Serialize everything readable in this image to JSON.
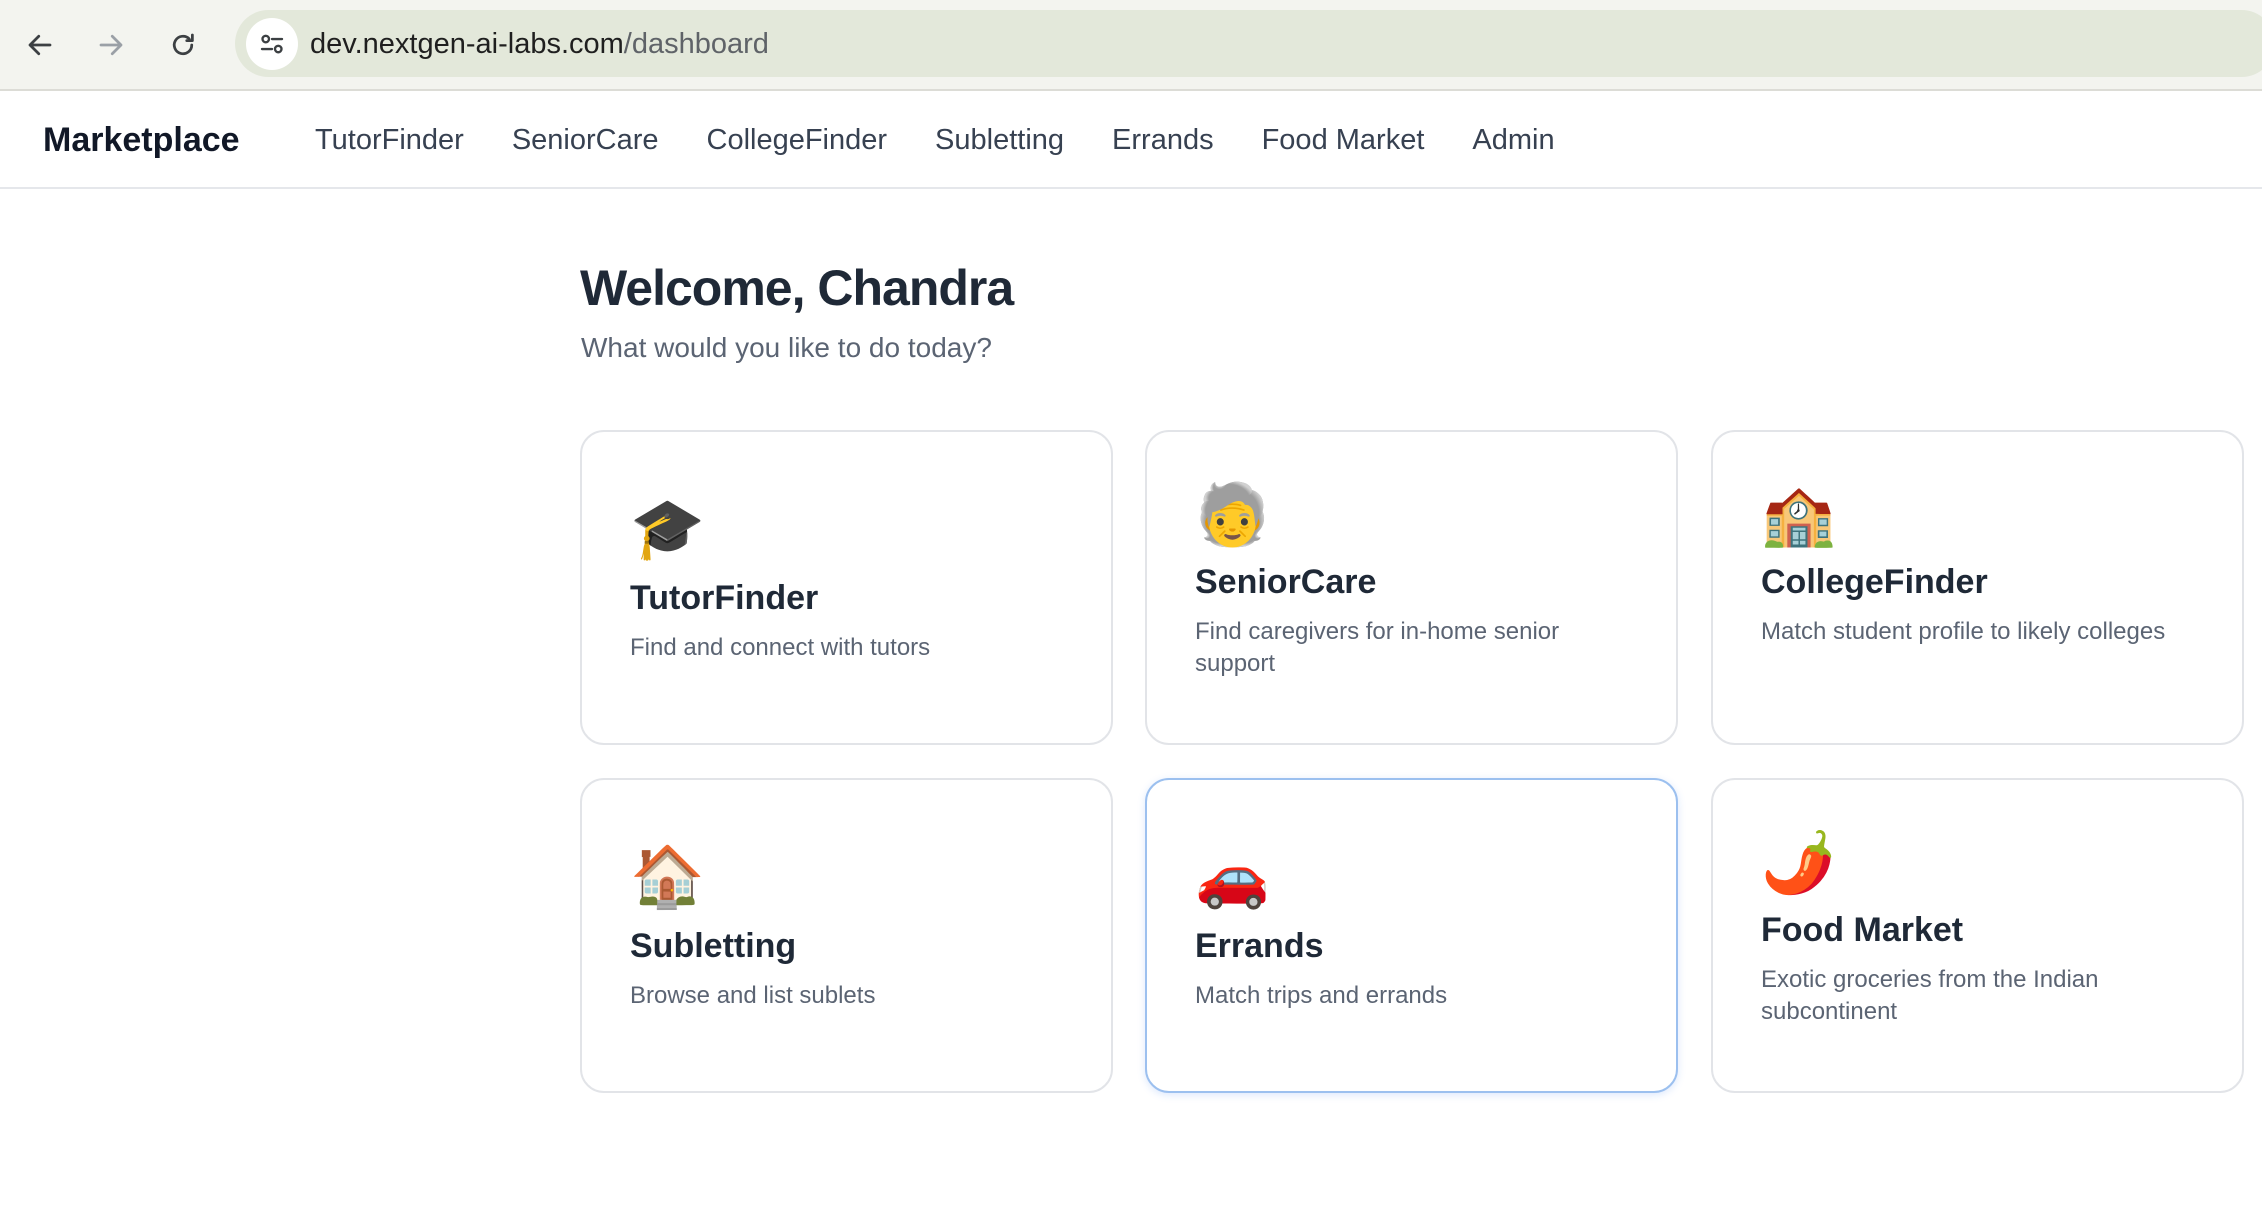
{
  "browser": {
    "url_host": "dev.nextgen-ai-labs.com",
    "url_path": "/dashboard",
    "back_icon": "arrow-left-icon",
    "forward_icon": "arrow-right-icon",
    "reload_icon": "reload-icon",
    "site_info_icon": "tune-icon"
  },
  "header": {
    "brand": "Marketplace",
    "nav": [
      "TutorFinder",
      "SeniorCare",
      "CollegeFinder",
      "Subletting",
      "Errands",
      "Food Market",
      "Admin"
    ]
  },
  "main": {
    "welcome": "Welcome, Chandra",
    "subtitle": "What would you like to do today?",
    "cards": [
      {
        "icon": "🎓",
        "icon_name": "graduation-cap-icon",
        "title": "TutorFinder",
        "desc": "Find and connect with tutors"
      },
      {
        "icon": "🧓",
        "icon_name": "older-person-icon",
        "title": "SeniorCare",
        "desc": "Find caregivers for in-home senior support"
      },
      {
        "icon": "🏫",
        "icon_name": "school-building-icon",
        "title": "CollegeFinder",
        "desc": "Match student profile to likely colleges"
      },
      {
        "icon": "🏠",
        "icon_name": "house-icon",
        "title": "Subletting",
        "desc": "Browse and list sublets"
      },
      {
        "icon": "🚗",
        "icon_name": "car-icon",
        "title": "Errands",
        "desc": "Match trips and errands"
      },
      {
        "icon": "🌶️",
        "icon_name": "chili-pepper-icon",
        "title": "Food Market",
        "desc": "Exotic groceries from the Indian subcontinent"
      }
    ]
  },
  "colors": {
    "chrome_bg": "#f3f4ef",
    "omnibox_bg": "#e3e8da",
    "text_primary": "#1f2937",
    "text_secondary": "#5b6473",
    "card_border": "#e2e4e8",
    "card_active_border": "#9cc0ef"
  }
}
